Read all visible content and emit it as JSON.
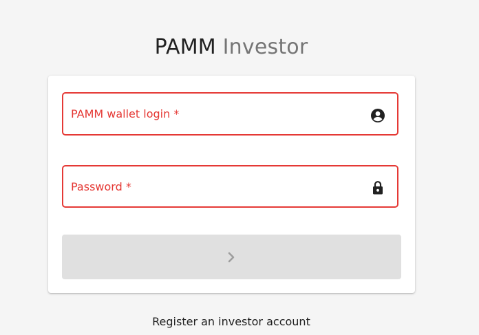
{
  "app": {
    "title_part1": "PAMM",
    "title_part2": "Investor"
  },
  "form": {
    "login_placeholder": "PAMM wallet login *",
    "login_value": "",
    "login_icon": "account-circle-icon",
    "password_placeholder": "Password *",
    "password_value": "",
    "password_icon": "lock-icon",
    "submit_icon": "chevron-right-icon",
    "submit_disabled": true
  },
  "footer": {
    "register_link": "Register an investor account"
  },
  "colors": {
    "error": "#e53935",
    "background": "#f5f5f5",
    "card": "#ffffff",
    "button_disabled": "#e0e0e0"
  }
}
